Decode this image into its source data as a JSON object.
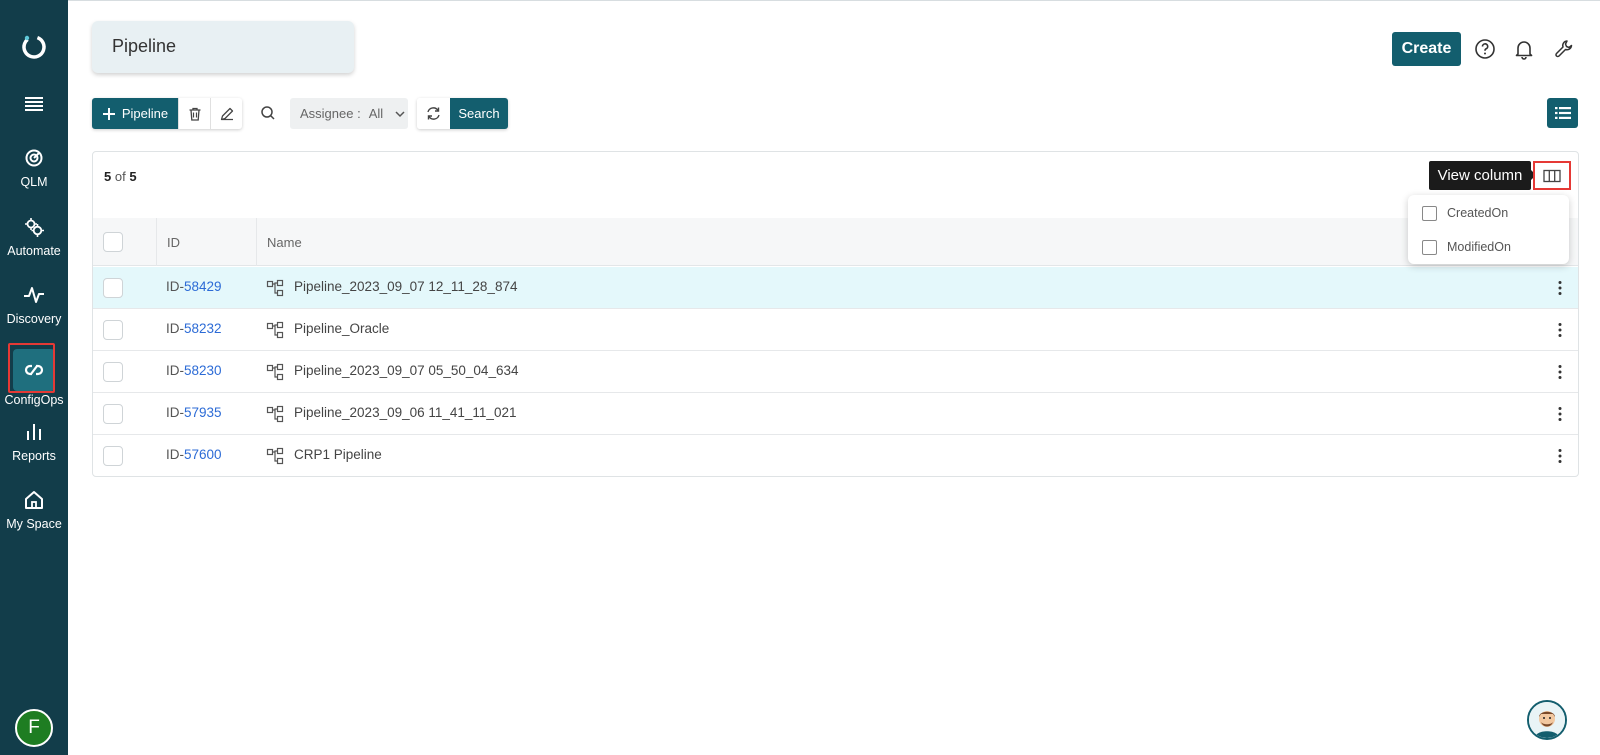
{
  "sidebar": {
    "items": [
      {
        "label": "QLM",
        "icon": "qlm-icon"
      },
      {
        "label": "Automate",
        "icon": "gears-icon"
      },
      {
        "label": "Discovery",
        "icon": "pulse-icon"
      },
      {
        "label": "ConfigOps",
        "icon": "sync-link-icon",
        "active": true
      },
      {
        "label": "Reports",
        "icon": "bar-chart-icon"
      },
      {
        "label": "My Space",
        "icon": "home-icon"
      }
    ],
    "user_initial": "F"
  },
  "header": {
    "page_title": "Pipeline",
    "create_label": "Create"
  },
  "toolbar": {
    "add_label": "Pipeline",
    "assignee_label": "Assignee :",
    "assignee_value": "All",
    "search_label": "Search"
  },
  "table": {
    "count_shown": "5",
    "count_of": "of",
    "count_total": "5",
    "columns": [
      "ID",
      "Name"
    ],
    "rows": [
      {
        "id_prefix": "ID-",
        "id_num": "58429",
        "name": "Pipeline_2023_09_07 12_11_28_874"
      },
      {
        "id_prefix": "ID-",
        "id_num": "58232",
        "name": "Pipeline_Oracle"
      },
      {
        "id_prefix": "ID-",
        "id_num": "58230",
        "name": "Pipeline_2023_09_07 05_50_04_634"
      },
      {
        "id_prefix": "ID-",
        "id_num": "57935",
        "name": "Pipeline_2023_09_06 11_41_11_021"
      },
      {
        "id_prefix": "ID-",
        "id_num": "57600",
        "name": "CRP1 Pipeline"
      }
    ]
  },
  "view_column": {
    "tooltip": "View column",
    "options": [
      "CreatedOn",
      "ModifiedOn"
    ]
  },
  "colors": {
    "sidebar": "#123d4a",
    "primary": "#135e6e",
    "link": "#2c6bd6",
    "highlight_row": "#e4f8fb",
    "focus_outline": "#e53935"
  }
}
